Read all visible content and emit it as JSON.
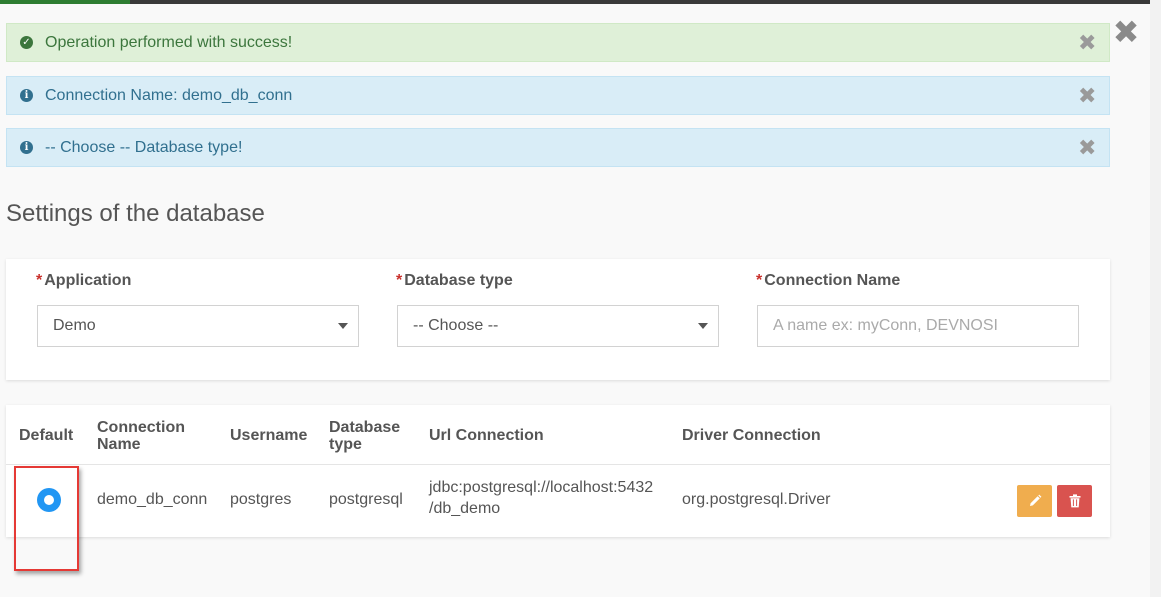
{
  "alerts": [
    {
      "type": "success",
      "icon": "check-circle-icon",
      "message": "Operation performed with success!"
    },
    {
      "type": "info",
      "icon": "info-circle-icon",
      "message": "Connection Name: demo_db_conn"
    },
    {
      "type": "info",
      "icon": "info-circle-icon",
      "message": "-- Choose -- Database type!"
    }
  ],
  "section_title": "Settings of the database",
  "form": {
    "required_marker": "*",
    "application": {
      "label": "Application",
      "value": "Demo"
    },
    "database_type": {
      "label": "Database type",
      "value": "-- Choose --"
    },
    "connection_name": {
      "label": "Connection Name",
      "placeholder": "A name ex: myConn, DEVNOSI"
    }
  },
  "table": {
    "headers": {
      "default": "Default",
      "connection_name_1": "Connection",
      "connection_name_2": "Name",
      "username": "Username",
      "database_type_1": "Database",
      "database_type_2": "type",
      "url": "Url Connection",
      "driver": "Driver Connection"
    },
    "rows": [
      {
        "default_selected": true,
        "connection_name": "demo_db_conn",
        "username": "postgres",
        "database_type": "postgresql",
        "url_line1": "jdbc:postgresql://localhost:5432",
        "url_line2": "/db_demo",
        "driver": "org.postgresql.Driver"
      }
    ]
  },
  "colors": {
    "success_bg": "#dff0d8",
    "info_bg": "#d9edf7",
    "required": "#c9302c",
    "radio_selected": "#2196f3",
    "edit_button": "#f0ad4e",
    "delete_button": "#d9534f",
    "highlight_border": "#e53935"
  }
}
